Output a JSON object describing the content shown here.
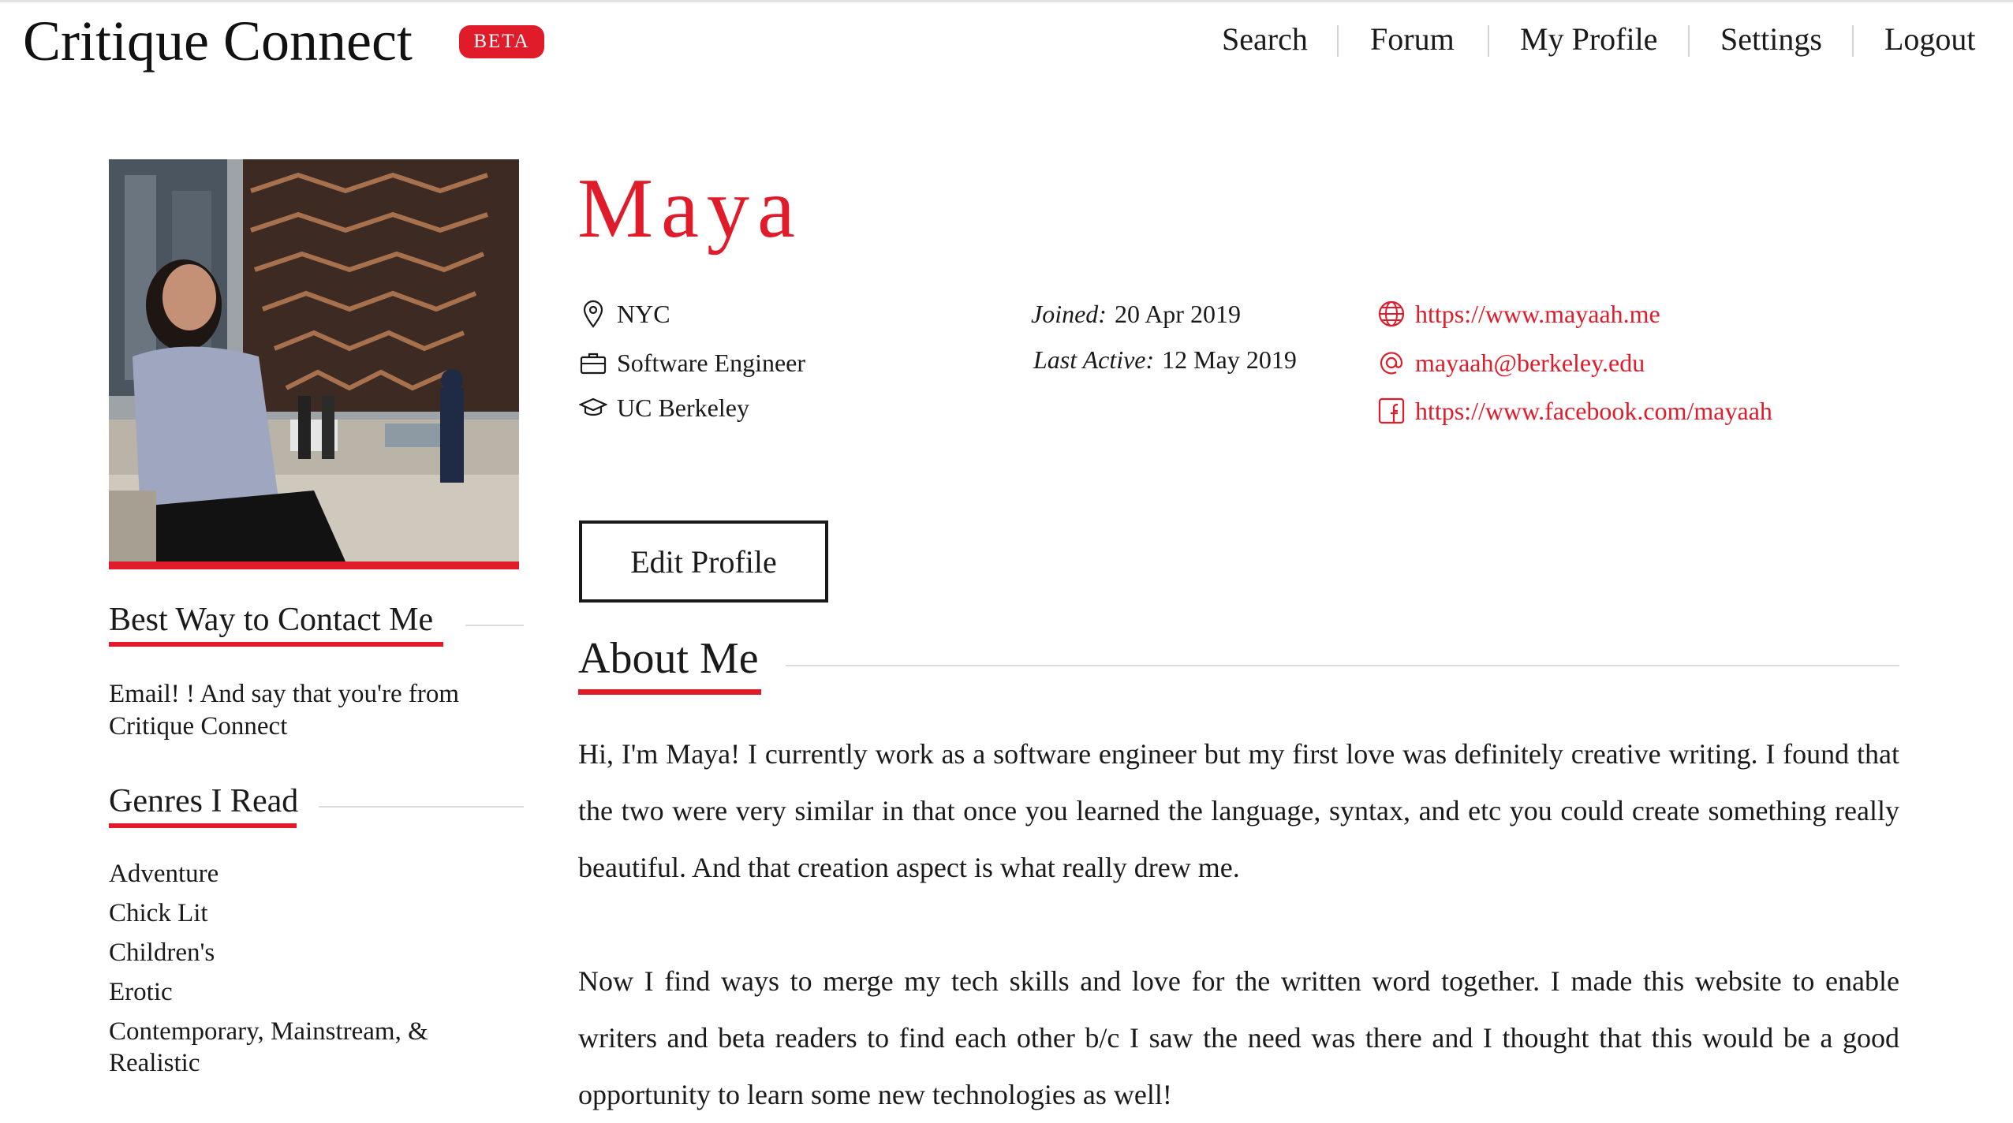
{
  "header": {
    "brand": "Critique Connect",
    "badge": "BETA",
    "nav": [
      "Search",
      "Forum",
      "My Profile",
      "Settings",
      "Logout"
    ]
  },
  "profile": {
    "name": "Maya",
    "location": "NYC",
    "occupation": "Software Engineer",
    "school": "UC Berkeley",
    "joined_label": "Joined:",
    "joined_value": "20 Apr 2019",
    "active_label": "Last Active:",
    "active_value": "12 May 2019",
    "website": "https://www.mayaah.me",
    "email": "mayaah@berkeley.edu",
    "facebook": "https://www.facebook.com/mayaah",
    "edit_label": "Edit Profile"
  },
  "sidebar": {
    "contact_title": "Best Way to Contact Me",
    "contact_text": "Email! ! And say that you're from Critique Connect",
    "genres_title": "Genres I Read",
    "genres": [
      "Adventure",
      "Chick Lit",
      "Children's",
      "Erotic",
      "Contemporary, Mainstream, & Realistic"
    ]
  },
  "about": {
    "title": "About Me",
    "p1": "Hi, I'm Maya! I currently work as a software engineer but my first love was definitely creative writing. I found that the two were very similar in that once you learned the language, syntax, and etc you could create something really beautiful. And that creation aspect is what really drew me.",
    "p2": "Now I find ways to merge my tech skills and love for the written word together. I made this website to enable writers and beta readers to find each other b/c I saw the need was there and I thought that this would be a good opportunity to learn some new technologies as well!"
  },
  "colors": {
    "accent": "#e01b2a",
    "text": "#1a1a1a",
    "rule": "#dcdcdc"
  },
  "icons": [
    "map-pin-icon",
    "briefcase-icon",
    "graduation-cap-icon",
    "globe-icon",
    "at-sign-icon",
    "facebook-icon"
  ]
}
